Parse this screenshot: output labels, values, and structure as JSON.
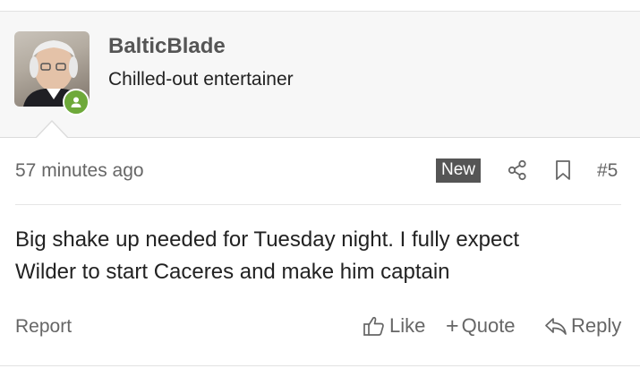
{
  "user": {
    "username": "BalticBlade",
    "title": "Chilled-out entertainer",
    "online_status_icon": "user-online-icon",
    "status_color": "#6ea93a"
  },
  "post": {
    "timestamp": "57 minutes ago",
    "new_badge": "New",
    "share_icon": "share-icon",
    "bookmark_icon": "bookmark-icon",
    "post_number": "#5",
    "body_line1": "Big shake up needed for Tuesday night. I fully expect",
    "body_line2": "Wilder to start Caceres and make him captain"
  },
  "actions": {
    "report_label": "Report",
    "like_label": "Like",
    "quote_label": "Quote",
    "reply_label": "Reply"
  }
}
